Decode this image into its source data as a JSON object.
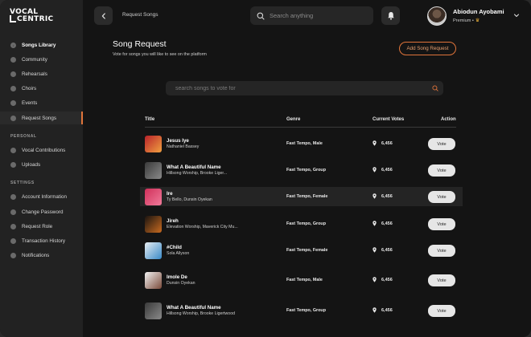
{
  "app": {
    "logo_line1": "VOCAL",
    "logo_line2": "CENTRIC",
    "accent_color": "#e0743a"
  },
  "sidebar": {
    "main_items": [
      {
        "label": "Songs Library",
        "icon": "music-icon"
      },
      {
        "label": "Community",
        "icon": "community-icon"
      },
      {
        "label": "Rehearsals",
        "icon": "rehearsal-icon"
      },
      {
        "label": "Choirs",
        "icon": "choir-icon"
      },
      {
        "label": "Events",
        "icon": "calendar-icon"
      },
      {
        "label": "Request Songs",
        "icon": "request-icon",
        "active": true
      }
    ],
    "personal_label": "PERSONAL",
    "personal_items": [
      {
        "label": "Vocal Contributions",
        "icon": "mic-icon"
      },
      {
        "label": "Uploads",
        "icon": "upload-icon"
      }
    ],
    "settings_label": "SETTINGS",
    "settings_items": [
      {
        "label": "Account Information",
        "icon": "account-icon"
      },
      {
        "label": "Change Password",
        "icon": "lock-icon"
      },
      {
        "label": "Request Role",
        "icon": "role-icon"
      },
      {
        "label": "Transaction History",
        "icon": "history-icon"
      },
      {
        "label": "Notifications",
        "icon": "bell-icon"
      }
    ]
  },
  "header": {
    "breadcrumb": "Request Songs",
    "search_placeholder": "Search anything",
    "user_name": "Abiodun Ayobami",
    "user_tier": "Premium •"
  },
  "main": {
    "title": "Song Request",
    "subtitle": "Vote for songs you will like to see on the platform",
    "add_button": "Add Song Request",
    "search_placeholder": "search songs to vote for",
    "columns": [
      "Title",
      "Genre",
      "Current Votes",
      "Action"
    ],
    "rows": [
      {
        "title": "Jesus Iye",
        "artist": "Nathaniel Bassey",
        "genre": "Fast Tempo, Male",
        "votes": "6,456",
        "action": "Vote",
        "thumb": [
          "#b8222a",
          "#f0a040"
        ]
      },
      {
        "title": "What A Beautiful Name",
        "artist": "Hillsong Worship, Brooke Liger...",
        "genre": "Fast Tempo, Group",
        "votes": "6,456",
        "action": "Vote",
        "thumb": [
          "#3a3a3a",
          "#8a8a8a"
        ]
      },
      {
        "title": "Ire",
        "artist": "Ty Bello, Dunsin Oyekan",
        "genre": "Fast Tempo, Female",
        "votes": "6,456",
        "action": "Vote",
        "thumb": [
          "#d0305a",
          "#f07a9a"
        ],
        "highlight": true
      },
      {
        "title": "Jireh",
        "artist": "Elevation Worship, Maverick City Mu...",
        "genre": "Fast Tempo, Group",
        "votes": "6,456",
        "action": "Vote",
        "thumb": [
          "#1a1410",
          "#c86a20"
        ]
      },
      {
        "title": "#Child",
        "artist": "Sola Allyson",
        "genre": "Fast Tempo, Female",
        "votes": "6,456",
        "action": "Vote",
        "thumb": [
          "#e8eef2",
          "#3a8ac8"
        ]
      },
      {
        "title": "Imole De",
        "artist": "Dunsin Oyekan",
        "genre": "Fast Tempo, Male",
        "votes": "6,456",
        "action": "Vote",
        "thumb": [
          "#f2f2f2",
          "#7a4a3a"
        ]
      },
      {
        "title": "What A Beautiful Name",
        "artist": "Hillsong Worship, Brooke Ligertwood",
        "genre": "Fast Tempo, Group",
        "votes": "6,456",
        "action": "Vote",
        "thumb": [
          "#3a3a3a",
          "#8a8a8a"
        ]
      }
    ]
  }
}
